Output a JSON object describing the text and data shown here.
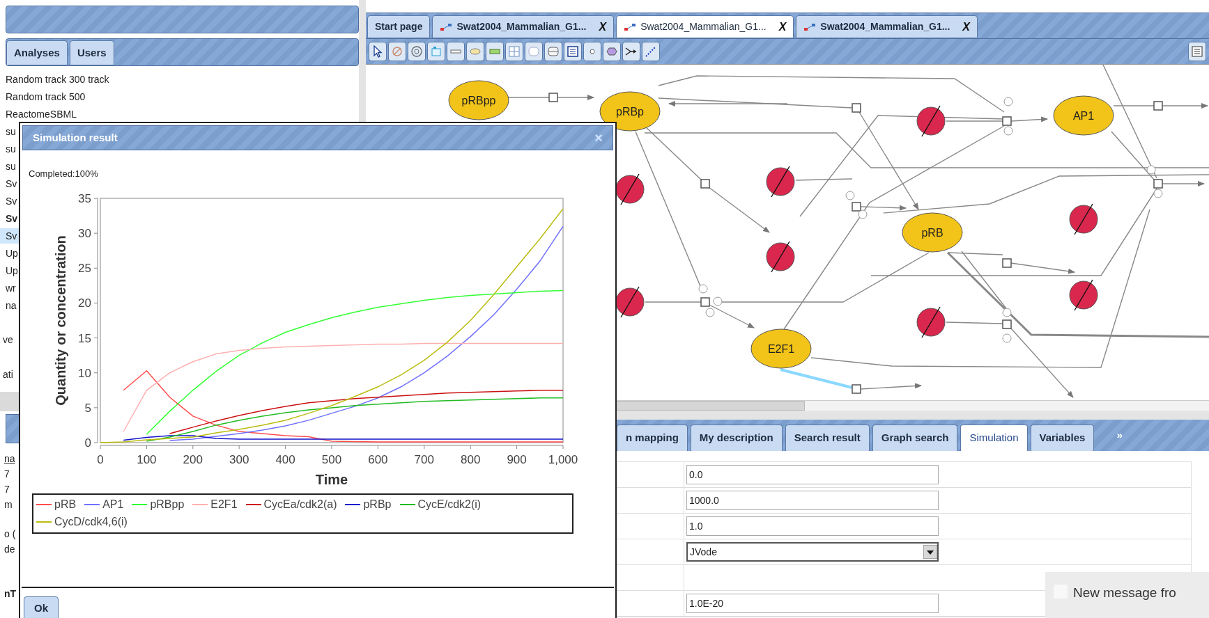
{
  "left_panel": {
    "tabs": [
      {
        "label": "Analyses"
      },
      {
        "label": "Users"
      }
    ],
    "items": [
      {
        "text": "Random track 300 track",
        "selected": false,
        "bold": false
      },
      {
        "text": "Random track 500",
        "selected": false,
        "bold": false
      },
      {
        "text": "ReactomeSBML",
        "selected": false,
        "bold": false
      },
      {
        "text": "su",
        "selected": false,
        "bold": false
      },
      {
        "text": "su",
        "selected": false,
        "bold": false
      },
      {
        "text": "su",
        "selected": false,
        "bold": false
      },
      {
        "text": "Sv",
        "selected": false,
        "bold": false
      },
      {
        "text": "Sv",
        "selected": false,
        "bold": false
      },
      {
        "text": "Sv",
        "selected": false,
        "bold": true
      },
      {
        "text": "Sv",
        "selected": true,
        "bold": false
      },
      {
        "text": "Up",
        "selected": false,
        "bold": false
      },
      {
        "text": "Up",
        "selected": false,
        "bold": false
      },
      {
        "text": "wr",
        "selected": false,
        "bold": false
      },
      {
        "text": "na",
        "selected": false,
        "bold": false
      }
    ],
    "more_items": [
      {
        "text": "ve"
      },
      {
        "text": "ati"
      }
    ],
    "lower_items": [
      {
        "text": "na",
        "kind": "link"
      },
      {
        "text": "7",
        "kind": "text"
      },
      {
        "text": "7",
        "kind": "text"
      },
      {
        "text": "m",
        "kind": "text"
      },
      {
        "text": "o (",
        "kind": "text"
      },
      {
        "text": "de",
        "kind": "text"
      },
      {
        "text": "nT",
        "kind": "bold"
      }
    ]
  },
  "editor_tabs": [
    {
      "label": "Start page",
      "kind": "start",
      "selected": false
    },
    {
      "label": "Swat2004_Mammalian_G1...",
      "close": "X",
      "kind": "diagram",
      "selected": false
    },
    {
      "label": "Swat2004_Mammalian_G1...",
      "close": "X",
      "kind": "diagram",
      "selected": true
    },
    {
      "label": "Swat2004_Mammalian_G1...",
      "close": "X",
      "kind": "diagram",
      "selected": false
    }
  ],
  "graph": {
    "nodes": [
      {
        "label": "pRBpp"
      },
      {
        "label": "pRBp"
      },
      {
        "label": "AP1"
      },
      {
        "label": "pRB"
      },
      {
        "label": "E2F1"
      }
    ]
  },
  "bottom_tabs": [
    {
      "label": "n mapping",
      "selected": false
    },
    {
      "label": "My description",
      "selected": false
    },
    {
      "label": "Search result",
      "selected": false
    },
    {
      "label": "Graph search",
      "selected": false
    },
    {
      "label": "Simulation",
      "selected": true
    },
    {
      "label": "Variables",
      "selected": false
    }
  ],
  "bottom_tabs_overflow": "»",
  "simulation_form": {
    "rows": [
      {
        "kind": "input",
        "value": "0.0"
      },
      {
        "kind": "input",
        "value": "1000.0"
      },
      {
        "kind": "input",
        "value": "1.0"
      },
      {
        "kind": "select",
        "value": "JVode"
      },
      {
        "kind": "empty"
      },
      {
        "kind": "input",
        "value": "1.0E-20"
      }
    ]
  },
  "dialog": {
    "title": "Simulation result",
    "close": "×",
    "status": "Completed:100%",
    "chart_data": {
      "type": "line",
      "xlabel": "Time",
      "ylabel": "Quantity or concentration",
      "x": [
        0,
        50,
        100,
        150,
        200,
        250,
        300,
        350,
        400,
        450,
        500,
        550,
        600,
        650,
        700,
        750,
        800,
        850,
        900,
        950,
        1000
      ],
      "series": [
        {
          "name": "pRB",
          "color": "#ff4d4d",
          "values": [
            null,
            7.5,
            10.3,
            6.5,
            3.8,
            2.5,
            1.6,
            1.3,
            1,
            0.85,
            0.2,
            0.15,
            0.1,
            0.1,
            0.1,
            0.1,
            0.1,
            0.1,
            0.1,
            0.1,
            0.1
          ]
        },
        {
          "name": "AP1",
          "color": "#6f6fff",
          "values": [
            null,
            null,
            null,
            0.3,
            0.5,
            0.9,
            1.3,
            1.8,
            2.4,
            3.2,
            4.2,
            5.2,
            6.4,
            8,
            10,
            12.4,
            15.2,
            18.3,
            22,
            26,
            31
          ]
        },
        {
          "name": "pRBpp",
          "color": "#33ff33",
          "values": [
            null,
            null,
            1.2,
            4.5,
            7.5,
            10.2,
            12.5,
            14.3,
            15.8,
            16.9,
            17.9,
            18.7,
            19.4,
            19.9,
            20.4,
            20.8,
            21.1,
            21.3,
            21.5,
            21.7,
            21.8
          ]
        },
        {
          "name": "E2F1",
          "color": "#ffb0b0",
          "values": [
            null,
            1.6,
            7.5,
            10,
            11.6,
            12.7,
            13.2,
            13.5,
            13.7,
            13.8,
            13.9,
            14,
            14.1,
            14.1,
            14.2,
            14.2,
            14.2,
            14.2,
            14.2,
            14.2,
            14.2
          ]
        },
        {
          "name": "CycEa/cdk2(a)",
          "color": "#cc1111",
          "values": [
            null,
            null,
            null,
            1.3,
            2.2,
            3.1,
            3.9,
            4.6,
            5.2,
            5.7,
            6,
            6.3,
            6.5,
            6.7,
            6.9,
            7.1,
            7.2,
            7.3,
            7.4,
            7.5,
            7.5
          ]
        },
        {
          "name": "pRBp",
          "color": "#1111cc",
          "values": [
            null,
            0.35,
            0.75,
            1,
            1,
            0.6,
            0.5,
            0.5,
            0.5,
            0.5,
            0.5,
            0.5,
            0.5,
            0.5,
            0.5,
            0.5,
            0.5,
            0.5,
            0.5,
            0.5,
            0.5
          ]
        },
        {
          "name": "CycE/cdk2(i)",
          "color": "#22bb22",
          "values": [
            null,
            null,
            0.2,
            0.8,
            1.6,
            2.5,
            3.2,
            3.8,
            4.3,
            4.7,
            5,
            5.3,
            5.5,
            5.7,
            5.9,
            6,
            6.1,
            6.2,
            6.3,
            6.4,
            6.4
          ]
        },
        {
          "name": "CycD/cdk4,6(i)",
          "color": "#bbbb11",
          "values": [
            0,
            0.1,
            0.4,
            0.6,
            0.8,
            1.4,
            1.9,
            2.5,
            3.2,
            4.2,
            5.3,
            6.6,
            8,
            9.7,
            11.8,
            14.4,
            17.5,
            21.2,
            25.2,
            29.2,
            33.5
          ]
        }
      ],
      "xlim": [
        0,
        1000
      ],
      "ylim": [
        0,
        35
      ],
      "xticks": [
        0,
        100,
        200,
        300,
        400,
        500,
        600,
        700,
        800,
        900,
        {
          "value": 1000,
          "label": "1,000"
        }
      ],
      "yticks": [
        0,
        5,
        10,
        15,
        20,
        25,
        30,
        35
      ]
    },
    "buttons": [
      "Ok"
    ]
  },
  "notification": {
    "text": "New message fro"
  }
}
